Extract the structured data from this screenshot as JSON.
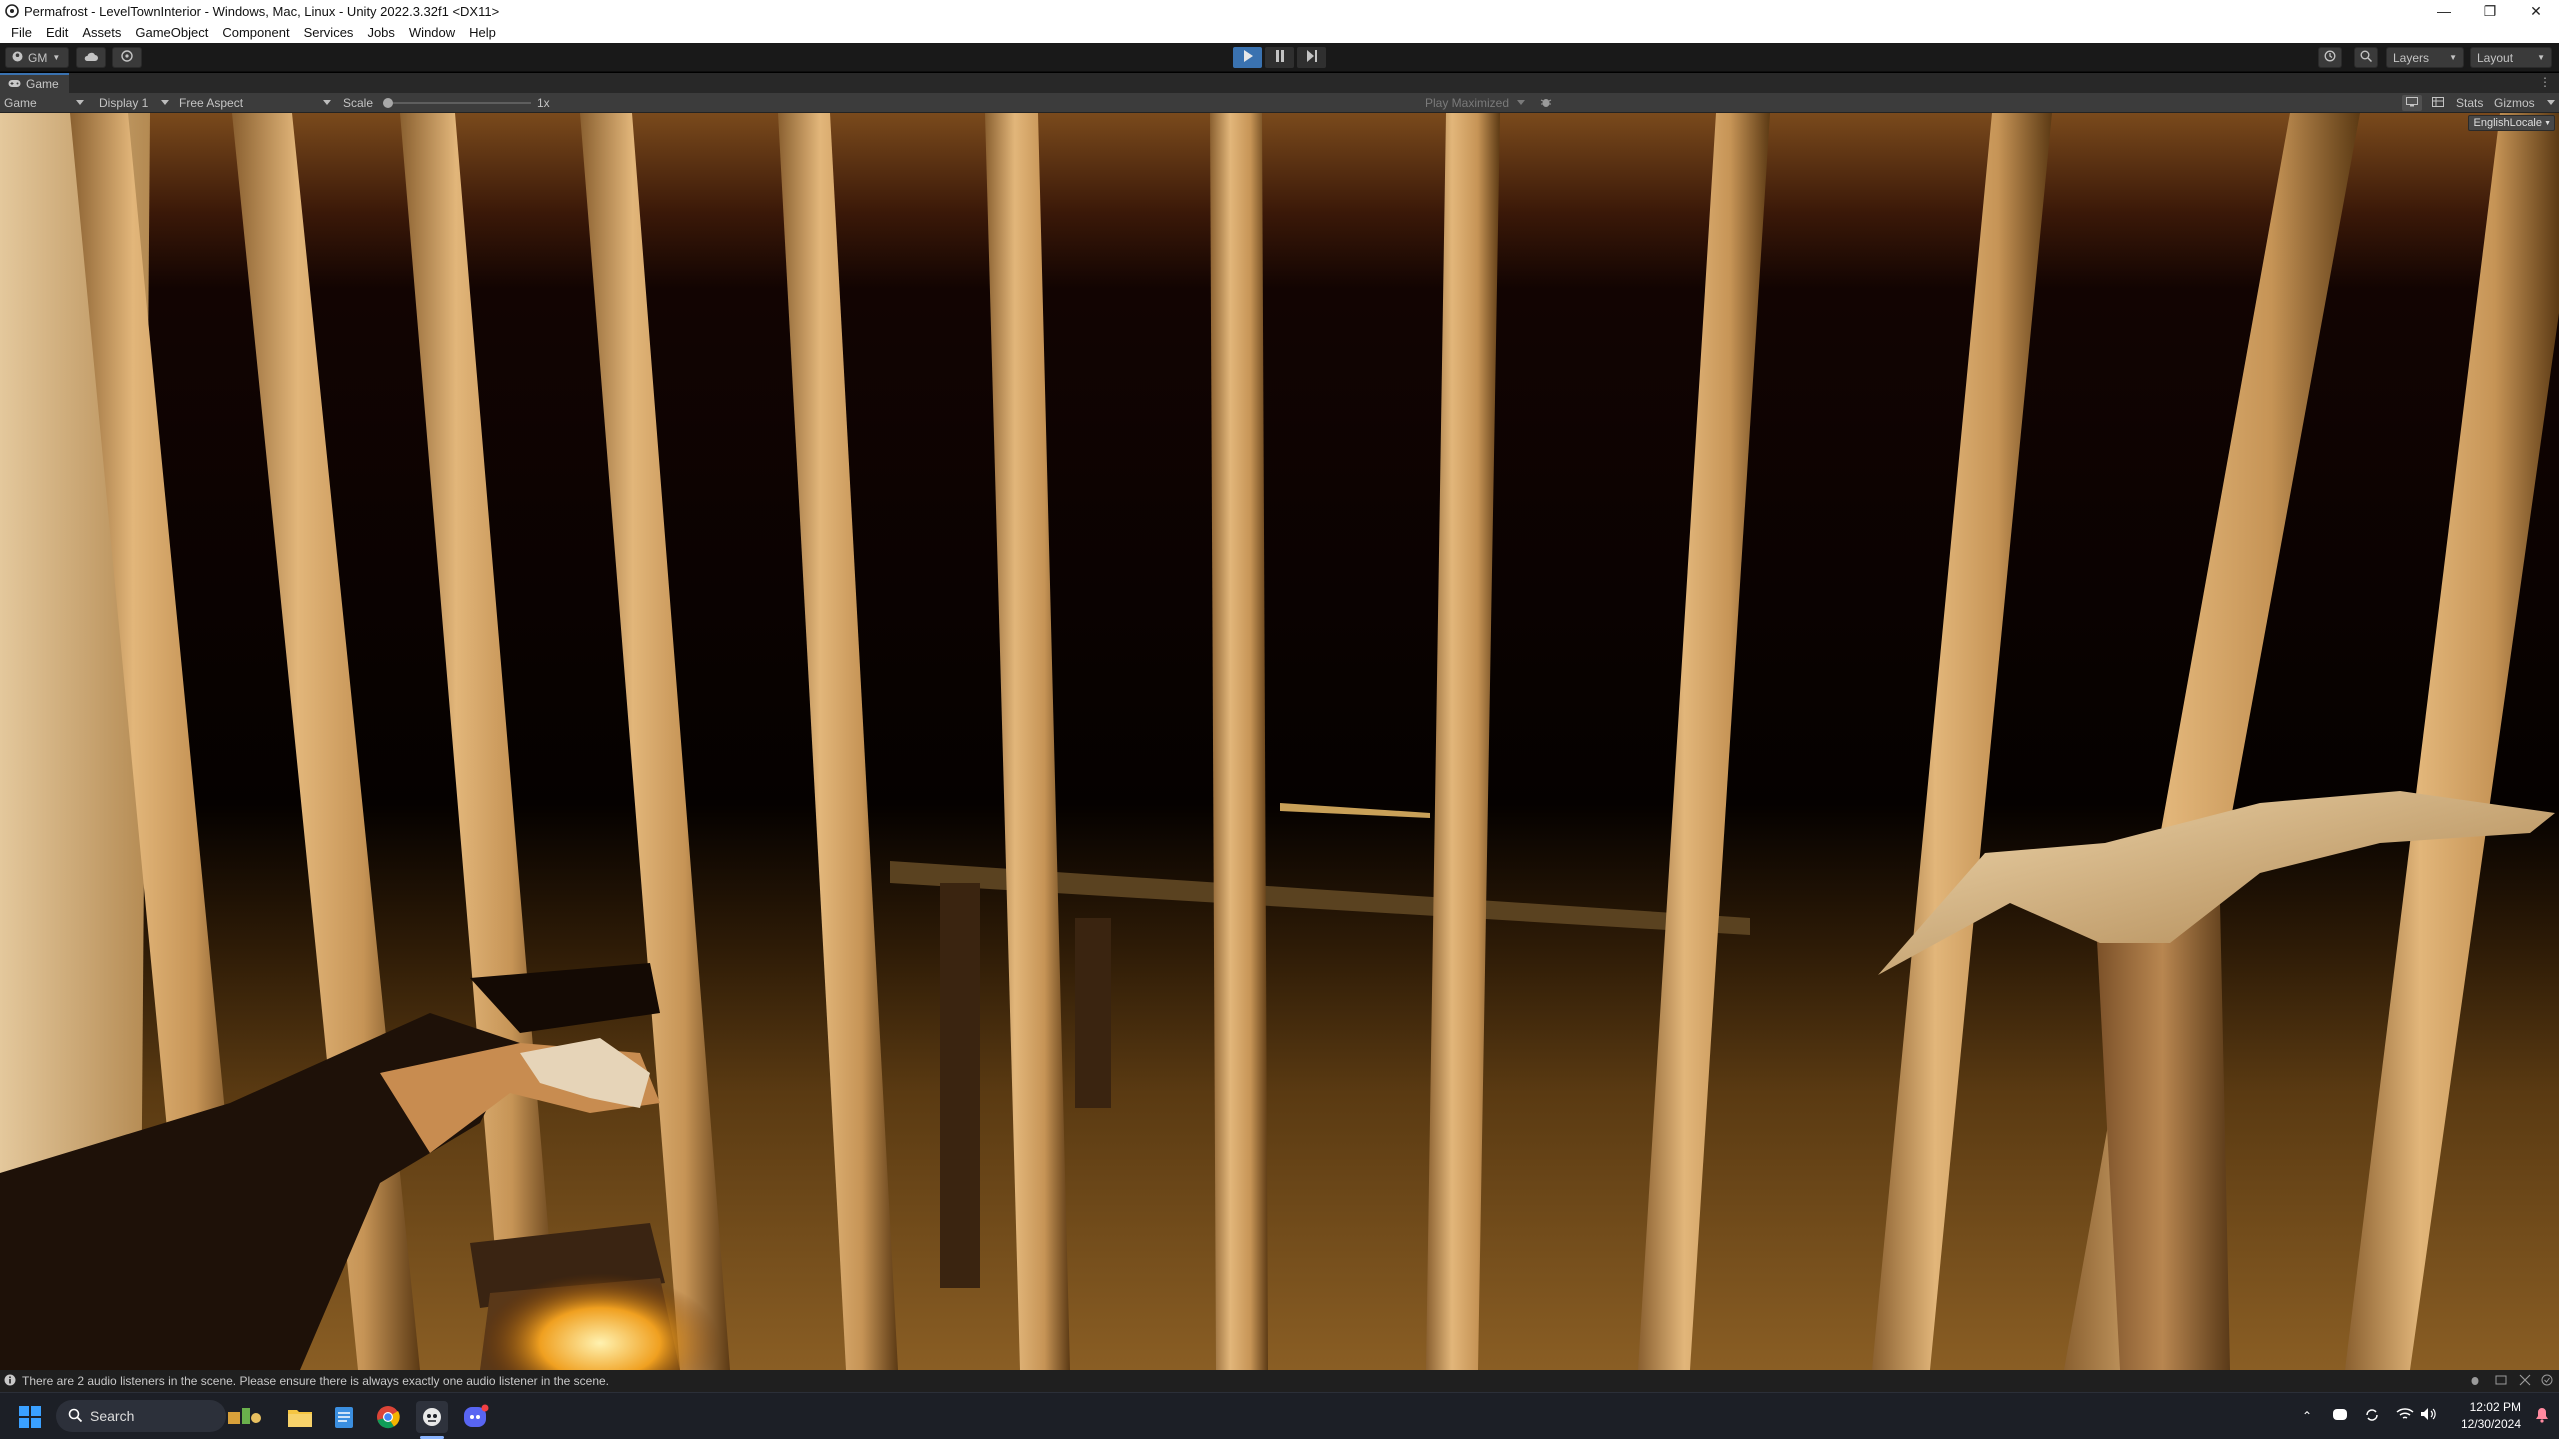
{
  "window": {
    "title": "Permafrost - LevelTownInterior - Windows, Mac, Linux - Unity 2022.3.32f1 <DX11>",
    "minimize_icon": "minimize-icon",
    "maximize_icon": "restore-icon",
    "close_icon": "close-icon"
  },
  "menubar": {
    "items": [
      "File",
      "Edit",
      "Assets",
      "GameObject",
      "Component",
      "Services",
      "Jobs",
      "Window",
      "Help"
    ]
  },
  "toolbar": {
    "account_label": "GM",
    "cloud_icon": "cloud-icon",
    "collab_icon": "collab-icon",
    "play_icon": "play-icon",
    "pause_icon": "pause-icon",
    "step_icon": "step-icon",
    "history_icon": "history-icon",
    "search_icon": "search-icon",
    "layers_label": "Layers",
    "layout_label": "Layout"
  },
  "game_tab": {
    "label": "Game",
    "icon": "gamepad-icon"
  },
  "game_toolbar": {
    "mode": "Game",
    "display": "Display 1",
    "aspect": "Free Aspect",
    "scale_label": "Scale",
    "scale_value": "1x",
    "scale_fraction": 0.0,
    "play_mode": "Play Maximized",
    "stats_label": "Stats",
    "gizmos_label": "Gizmos"
  },
  "viewport": {
    "locale_label": "EnglishLocale"
  },
  "statusbar": {
    "message": "There are 2 audio listeners in the scene. Please ensure there is always exactly one audio listener in the scene."
  },
  "taskbar": {
    "search_placeholder": "Search",
    "time": "12:02 PM",
    "date": "12/30/2024",
    "apps": [
      "file-explorer-icon",
      "notepad-icon",
      "chrome-icon",
      "unity-icon",
      "discord-icon"
    ]
  },
  "colors": {
    "editor_dark": "#191919",
    "panel": "#3c3c3c",
    "accent": "#3a72b0",
    "bar_light": "#d8ab70",
    "sky": "#0a0300"
  }
}
